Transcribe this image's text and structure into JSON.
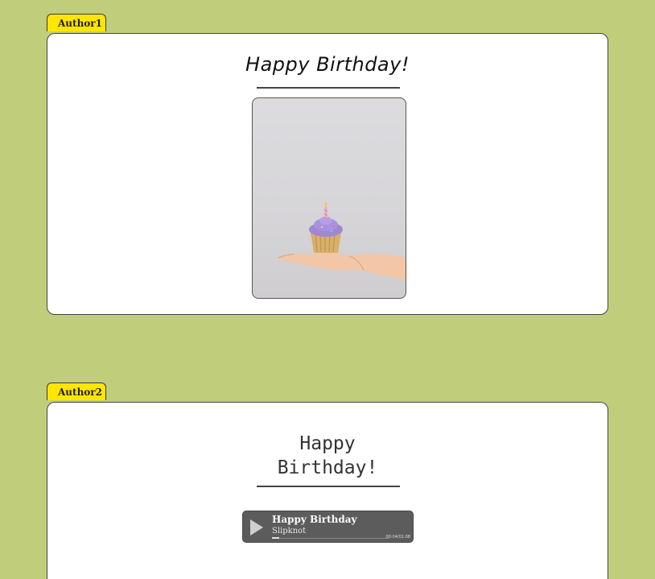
{
  "posts": [
    {
      "author": "Author1",
      "title": "Happy Birthday!",
      "image": {
        "subject": "cupcake-on-hand-image"
      }
    },
    {
      "author": "Author2",
      "title_lines": [
        "Happy",
        "Birthday!"
      ],
      "player": {
        "track_title": "Happy Birthday",
        "artist": "Slipknot",
        "time": "00:04/01:08",
        "progress": 0.059,
        "play_icon": "play-icon"
      }
    }
  ]
}
